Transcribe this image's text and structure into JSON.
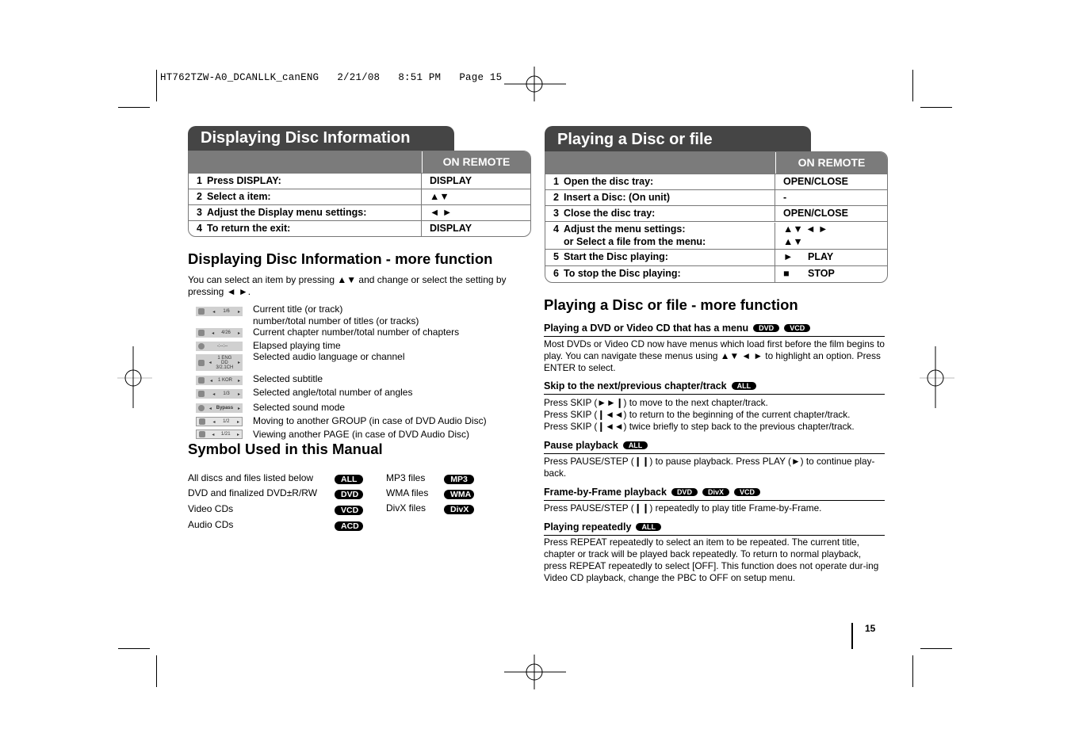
{
  "slug": "HT762TZW-A0_DCANLLK_canENG   2/21/08   8:51 PM   Page 15",
  "left": {
    "section_title": "Displaying Disc Information",
    "table": {
      "header_col2": "ON REMOTE",
      "rows": [
        {
          "num": "1",
          "step": "Press DISPLAY:",
          "remote": "DISPLAY"
        },
        {
          "num": "2",
          "step": "Select a item:",
          "remote": "▲▼"
        },
        {
          "num": "3",
          "step": "Adjust the Display menu settings:",
          "remote": "◄ ►"
        },
        {
          "num": "4",
          "step": "To return the exit:",
          "remote": "DISPLAY"
        }
      ]
    },
    "more_title": "Displaying Disc Information - more function",
    "more_intro": "You can select an item by pressing ▲▼ and change or select the setting by pressing ◄ ►.",
    "display_items": [
      {
        "icon": "title-icon",
        "value": "1/6",
        "desc": "Current title (or track)\nnumber/total number of titles (or tracks)"
      },
      {
        "icon": "chapter-icon",
        "value": "4/26",
        "desc": "Current chapter number/total number of chapters"
      },
      {
        "icon": "clock-icon",
        "value": "-:--:--",
        "desc": "Elapsed playing time"
      },
      {
        "icon": "audio-icon",
        "value": "1 ENG DD 3/2.1CH",
        "desc": "Selected audio language or channel"
      },
      {
        "icon": "subtitle-icon",
        "value": "1 KOR",
        "desc": "Selected subtitle"
      },
      {
        "icon": "angle-icon",
        "value": "1/3",
        "desc": "Selected angle/total number of angles"
      },
      {
        "icon": "sound-icon",
        "value": "Bypass",
        "desc": "Selected sound mode"
      },
      {
        "icon": "group-icon",
        "value": "1/2",
        "desc": "Moving to another GROUP (in case of DVD Audio Disc)"
      },
      {
        "icon": "page-icon",
        "value": "1/21",
        "desc": "Viewing another PAGE (in case of DVD Audio Disc)"
      }
    ],
    "symbol_title": "Symbol Used in this Manual",
    "symbols_left": [
      {
        "label": "All discs and files listed below",
        "badge": "ALL"
      },
      {
        "label": "DVD and finalized DVD±R/RW",
        "badge": "DVD"
      },
      {
        "label": "Video CDs",
        "badge": "VCD"
      },
      {
        "label": "Audio CDs",
        "badge": "ACD"
      }
    ],
    "symbols_right": [
      {
        "label": "MP3 files",
        "badge": "MP3"
      },
      {
        "label": "WMA files",
        "badge": "WMA"
      },
      {
        "label": "DivX files",
        "badge": "DivX"
      }
    ]
  },
  "right": {
    "section_title": "Playing a Disc or file",
    "table": {
      "header_col2": "ON REMOTE",
      "rows": [
        {
          "num": "1",
          "step": "Open the disc tray:",
          "remote": "OPEN/CLOSE"
        },
        {
          "num": "2",
          "step": "Insert a Disc: (On unit)",
          "remote": "-"
        },
        {
          "num": "3",
          "step": "Close the disc tray:",
          "remote": "OPEN/CLOSE"
        },
        {
          "num": "4",
          "step": "Adjust the menu settings:",
          "step2": "or Select a file from the menu:",
          "remote": "▲▼ ◄ ►",
          "remote2": "▲▼"
        },
        {
          "num": "5",
          "step": "Start the Disc playing:",
          "remote_icon": "►",
          "remote": "PLAY"
        },
        {
          "num": "6",
          "step": "To stop the Disc playing:",
          "remote_icon": "■",
          "remote": "STOP"
        }
      ]
    },
    "more_title": "Playing a Disc or file - more function",
    "subsections": [
      {
        "title": "Playing a DVD or Video CD that has a menu",
        "badges": [
          "DVD",
          "VCD"
        ],
        "body": [
          "Most DVDs or Video CD now have menus which load first before the film begins to play. You can navigate these menus using ▲▼ ◄ ► to highlight an option. Press ENTER to select."
        ]
      },
      {
        "title": "Skip to the next/previous chapter/track",
        "badges": [
          "ALL"
        ],
        "body": [
          "Press SKIP (►►❙) to move to the next chapter/track.",
          "Press SKIP (❙◄◄) to return to the beginning of the current chapter/track.",
          "Press SKIP (❙◄◄) twice briefly to step back to the previous chapter/track."
        ]
      },
      {
        "title": "Pause playback",
        "badges": [
          "ALL"
        ],
        "body": [
          "Press PAUSE/STEP (❙❙) to pause playback. Press PLAY (►) to continue play-back."
        ]
      },
      {
        "title": "Frame-by-Frame playback",
        "badges": [
          "DVD",
          "DivX",
          "VCD"
        ],
        "body": [
          "Press PAUSE/STEP (❙❙) repeatedly to play title Frame-by-Frame."
        ]
      },
      {
        "title": "Playing repeatedly",
        "badges": [
          "ALL"
        ],
        "body": [
          "Press REPEAT repeatedly to select an item to be repeated. The current title, chapter or track will be played back repeatedly. To return to normal playback, press REPEAT repeatedly to select [OFF]. This function does not operate dur-ing Video CD playback, change the PBC to OFF on setup menu."
        ]
      }
    ]
  },
  "page_number": "15"
}
